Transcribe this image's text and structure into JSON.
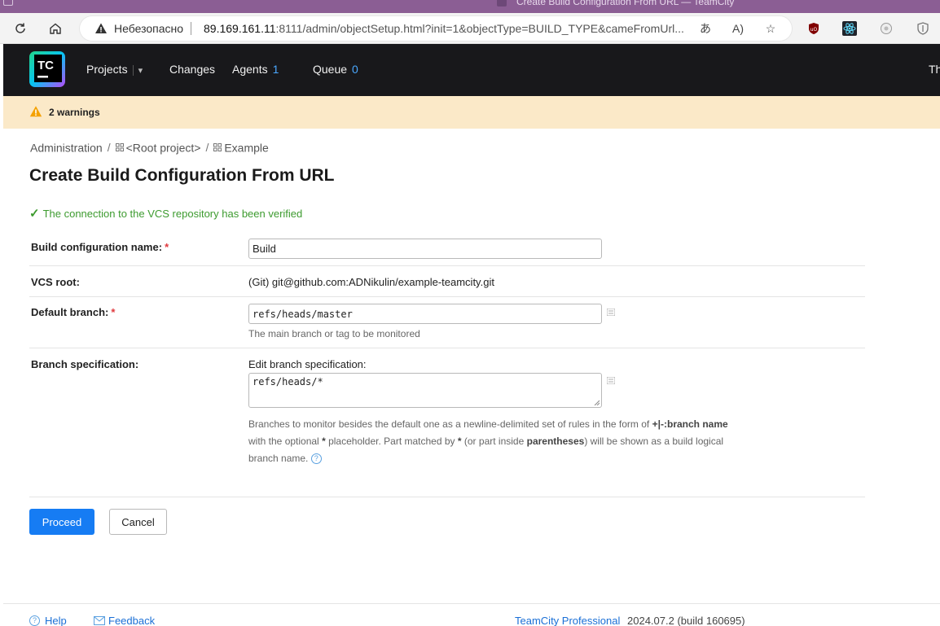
{
  "browser": {
    "tab_title": "Create Build Configuration From URL — TeamCity",
    "security_label": "Небезопасно",
    "url_host": "89.169.161.11",
    "url_rest": ":8111/admin/objectSetup.html?init=1&objectType=BUILD_TYPE&cameFromUrl..."
  },
  "header": {
    "nav": [
      {
        "label": "Projects"
      },
      {
        "label": "Changes"
      },
      {
        "label": "Agents",
        "count": "1"
      },
      {
        "label": "Queue",
        "count": "0"
      }
    ],
    "right_text": "Th"
  },
  "warnings": {
    "text": "2 warnings"
  },
  "breadcrumb": {
    "items": [
      "Administration",
      "<Root project>",
      "Example"
    ],
    "separator": "/"
  },
  "page": {
    "title": "Create Build Configuration From URL",
    "verified_message": "The connection to the VCS repository has been verified"
  },
  "form": {
    "name": {
      "label": "Build configuration name:",
      "value": "Build"
    },
    "vcs_root": {
      "label": "VCS root:",
      "value": "(Git) git@github.com:ADNikulin/example-teamcity.git"
    },
    "default_branch": {
      "label": "Default branch:",
      "value": "refs/heads/master",
      "hint": "The main branch or tag to be monitored"
    },
    "branch_spec": {
      "label": "Branch specification:",
      "edit_label": "Edit branch specification:",
      "value": "refs/heads/*",
      "desc_1": "Branches to monitor besides the default one as a newline-delimited set of rules in the form of",
      "desc_1_bold": "+|-:branch name",
      "desc_2a": "with the optional",
      "desc_2b": "placeholder. Part matched by",
      "desc_2c": "(or part inside",
      "desc_2d": "parentheses",
      "desc_2e": ") will be shown as a build logical",
      "star": "*",
      "desc_3": "branch name."
    },
    "required_mark": "*"
  },
  "buttons": {
    "proceed": "Proceed",
    "cancel": "Cancel"
  },
  "footer": {
    "help": "Help",
    "feedback": "Feedback",
    "product": "TeamCity Professional",
    "version": "2024.07.2 (build 160695)"
  },
  "colors": {
    "accent": "#167cf3",
    "verified": "#3d9b2f",
    "header_bg": "#18181b",
    "warning_bg": "#fbe9c8"
  }
}
